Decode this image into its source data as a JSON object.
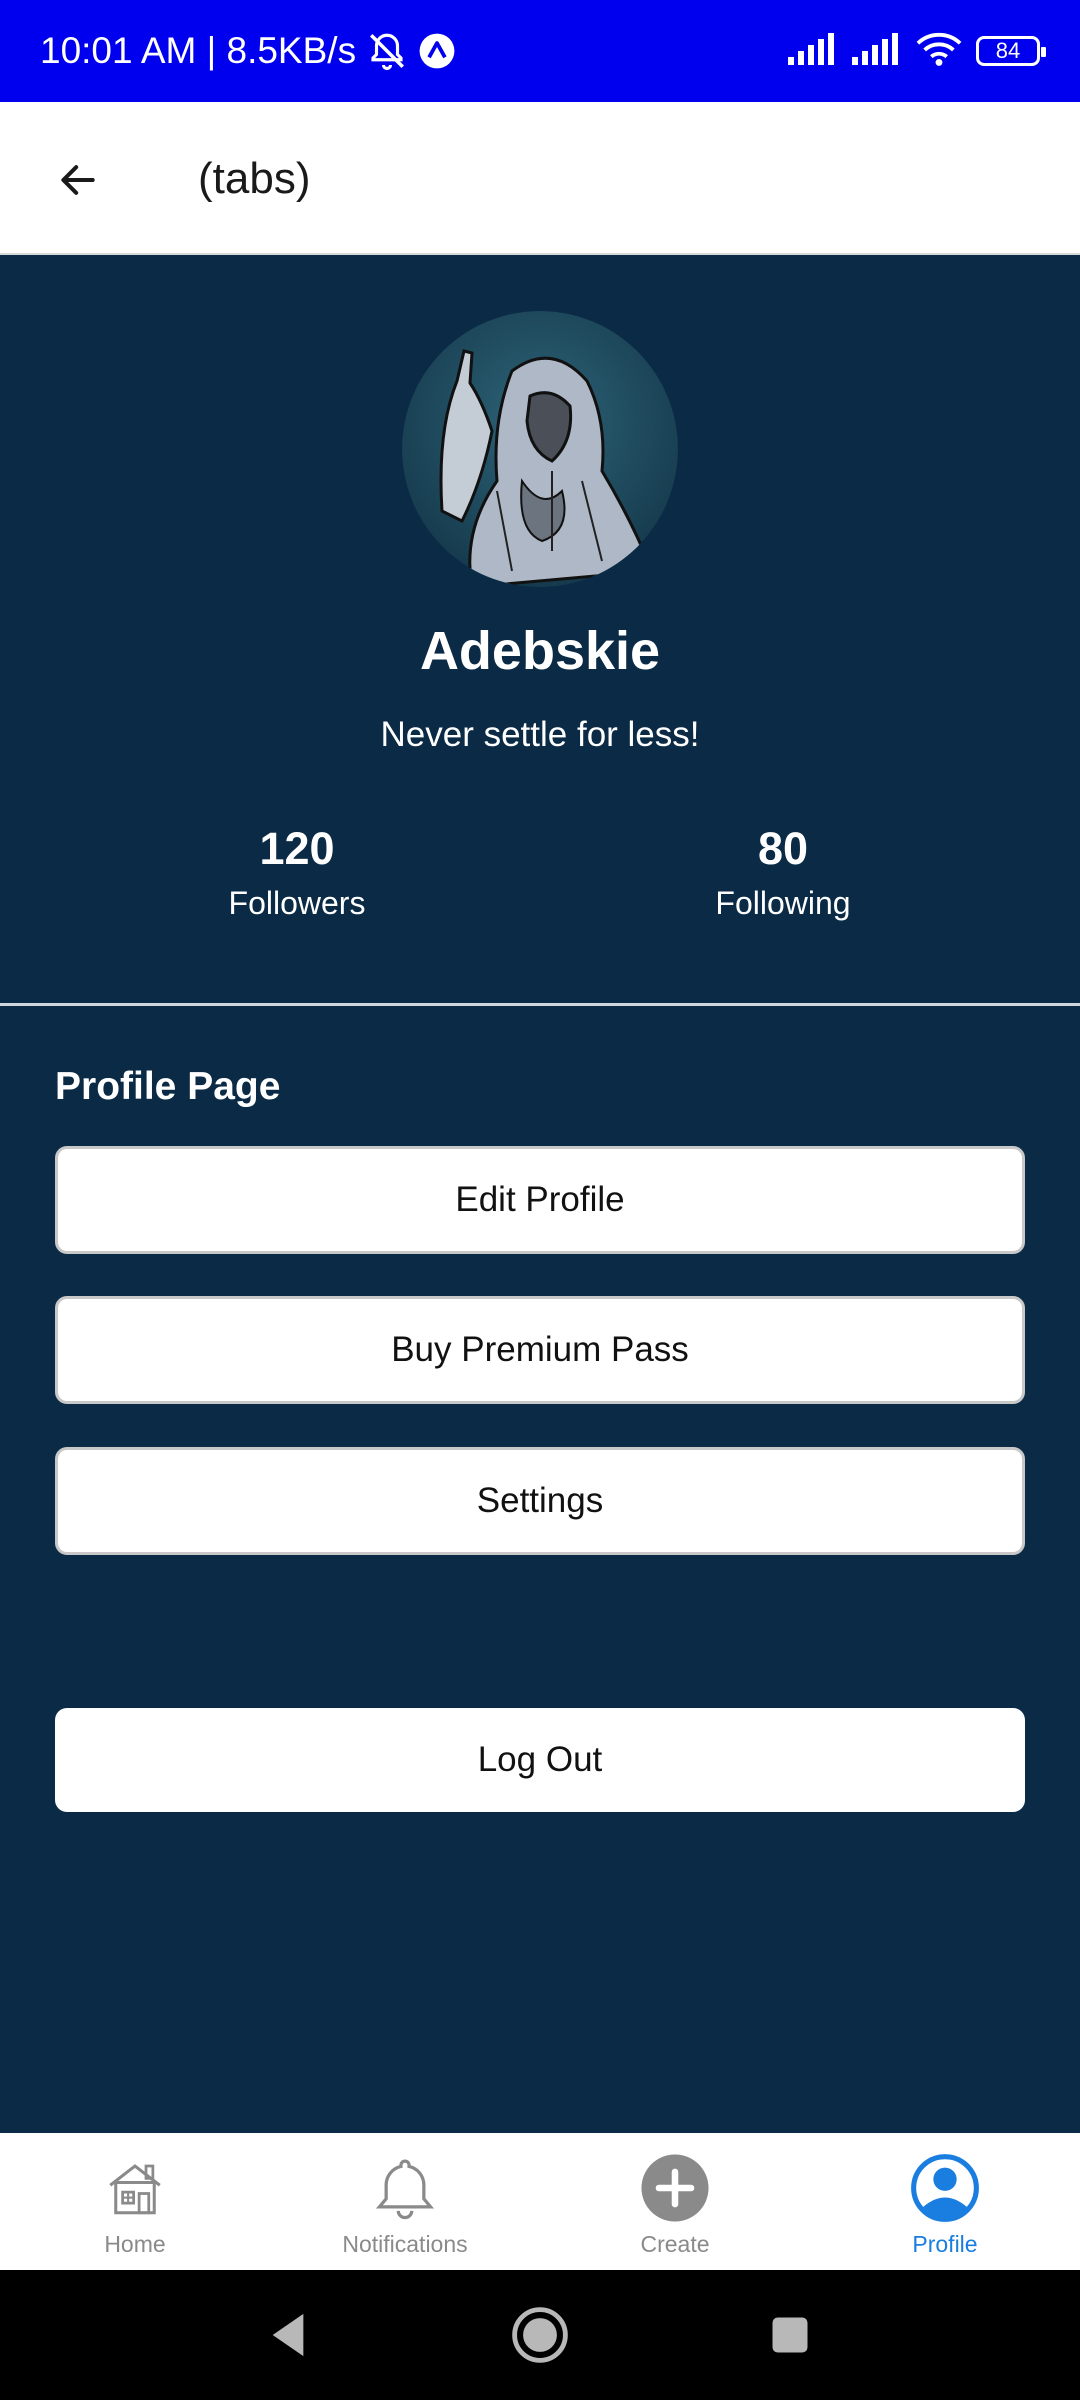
{
  "status_bar": {
    "time_speed": "10:01 AM | 8.5KB/s",
    "battery": "84"
  },
  "app_bar": {
    "title": "(tabs)"
  },
  "profile": {
    "username": "Adebskie",
    "bio": "Never settle for less!",
    "followers_count": "120",
    "followers_label": "Followers",
    "following_count": "80",
    "following_label": "Following"
  },
  "section": {
    "title": "Profile Page"
  },
  "menu": {
    "edit_profile": "Edit Profile",
    "buy_premium": "Buy Premium Pass",
    "settings": "Settings",
    "log_out": "Log Out"
  },
  "bottom_nav": {
    "items": [
      {
        "label": "Home",
        "icon": "house-icon"
      },
      {
        "label": "Notifications",
        "icon": "bell-icon"
      },
      {
        "label": "Create",
        "icon": "plus-circle-icon"
      },
      {
        "label": "Profile",
        "icon": "user-circle-icon"
      }
    ],
    "active": "Profile"
  },
  "colors": {
    "status_bar": "#0000ee",
    "background": "#0a2a45",
    "active_tab": "#1a7ee0",
    "inactive_tab": "#8a8a8a"
  }
}
